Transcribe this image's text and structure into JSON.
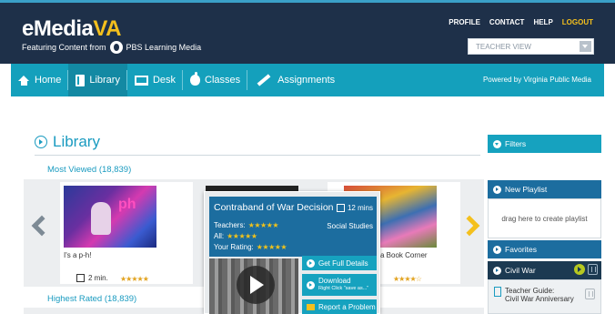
{
  "header": {
    "brand_main": "eMedia",
    "brand_accent": "VA",
    "featuring_label": "Featuring Content from",
    "partner_name": "PBS Learning Media",
    "topnav": [
      {
        "label": "PROFILE"
      },
      {
        "label": "CONTACT"
      },
      {
        "label": "HELP"
      },
      {
        "label": "LOGOUT"
      }
    ],
    "view_select": "TEACHER VIEW"
  },
  "mainnav": {
    "items": [
      {
        "label": "Home",
        "icon": "home-icon"
      },
      {
        "label": "Library",
        "icon": "library-icon"
      },
      {
        "label": "Desk",
        "icon": "desk-icon"
      },
      {
        "label": "Classes",
        "icon": "apple-icon"
      },
      {
        "label": "Assignments",
        "icon": "pencil-icon"
      }
    ],
    "powered_by": "Powered by Virginia Public Media"
  },
  "library": {
    "title": "Library",
    "most_viewed": "Most Viewed (18,839)",
    "highest_rated": "Highest Rated (18,839)",
    "cards": [
      {
        "title": "I's a p-h!",
        "duration": "2 min.",
        "stars": "★★★★★"
      },
      {
        "title": "a Book Corner",
        "stars": "★★★★☆"
      }
    ]
  },
  "popup": {
    "title": "Contraband of War Decision",
    "duration": "12 mins",
    "teachers_label": "Teachers:",
    "teachers_stars": "★★★★★",
    "all_label": "All:",
    "all_stars": "★★★★★",
    "rating_label": "Your Rating:",
    "rating_stars": "★★★★★",
    "subject": "Social Studies",
    "buttons": {
      "details": "Get Full Details",
      "download": "Download",
      "download_sub": "Right Click \"save as...\"",
      "report": "Report a Problem"
    }
  },
  "sidebar": {
    "filters": "Filters",
    "new_playlist": "New Playlist",
    "drag_hint": "drag here to create playlist",
    "favorites": "Favorites",
    "playlist_name": "Civil War",
    "item_line1": "Teacher Guide:",
    "item_line2": "Civil War Anniversary"
  },
  "colors": {
    "header_bg": "#1e3049",
    "accent_yellow": "#f4c01d",
    "nav_bg": "#14a0bc",
    "link_blue": "#1a9bc0",
    "popup_head": "#1c6d9f"
  }
}
